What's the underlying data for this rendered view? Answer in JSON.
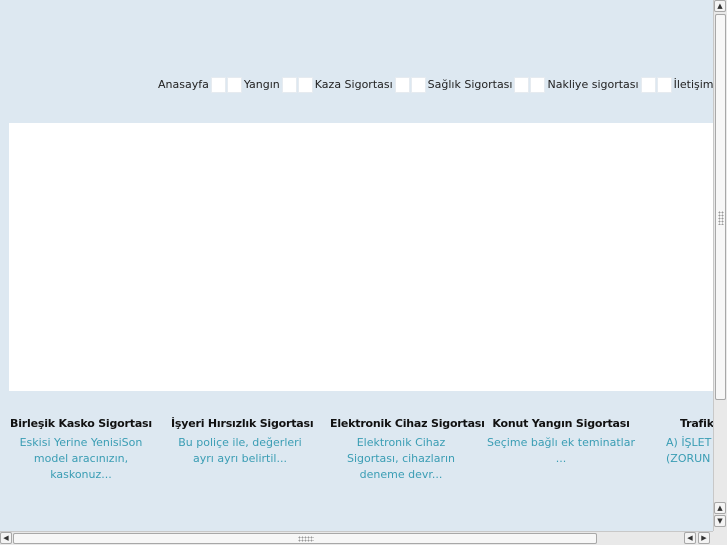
{
  "nav": {
    "items": [
      {
        "label": "Anasayfa"
      },
      {
        "label": "Yangın"
      },
      {
        "label": "Kaza Sigortası"
      },
      {
        "label": "Sağlık Sigortası"
      },
      {
        "label": "Nakliye sigortası"
      },
      {
        "label": "İletişim"
      }
    ]
  },
  "products": [
    {
      "title": "Birleşik Kasko Sigortası",
      "desc": "Eskisi Yerine YenisiSon model aracınızın, kaskonuz..."
    },
    {
      "title": "İşyeri Hırsızlık Sigortası",
      "desc": "Bu poliçe ile, değerleri ayrı ayrı belirtil..."
    },
    {
      "title": "Elektronik Cihaz Sigortası",
      "desc": "Elektronik Cihaz Sigortası, cihazların deneme devr..."
    },
    {
      "title": "Konut Yangın Sigortası",
      "desc": "Seçime bağlı ek teminatlar  ..."
    },
    {
      "title": "Trafik",
      "desc": "A) İŞLET (ZORUN"
    }
  ],
  "scrollbar": {
    "up_arrow": "▲",
    "down_arrow": "▼",
    "left_arrow": "◀",
    "right_arrow": "▶"
  },
  "colors": {
    "page_background": "#dde8f1",
    "description_text": "#3a9db4",
    "title_text": "#111111"
  }
}
